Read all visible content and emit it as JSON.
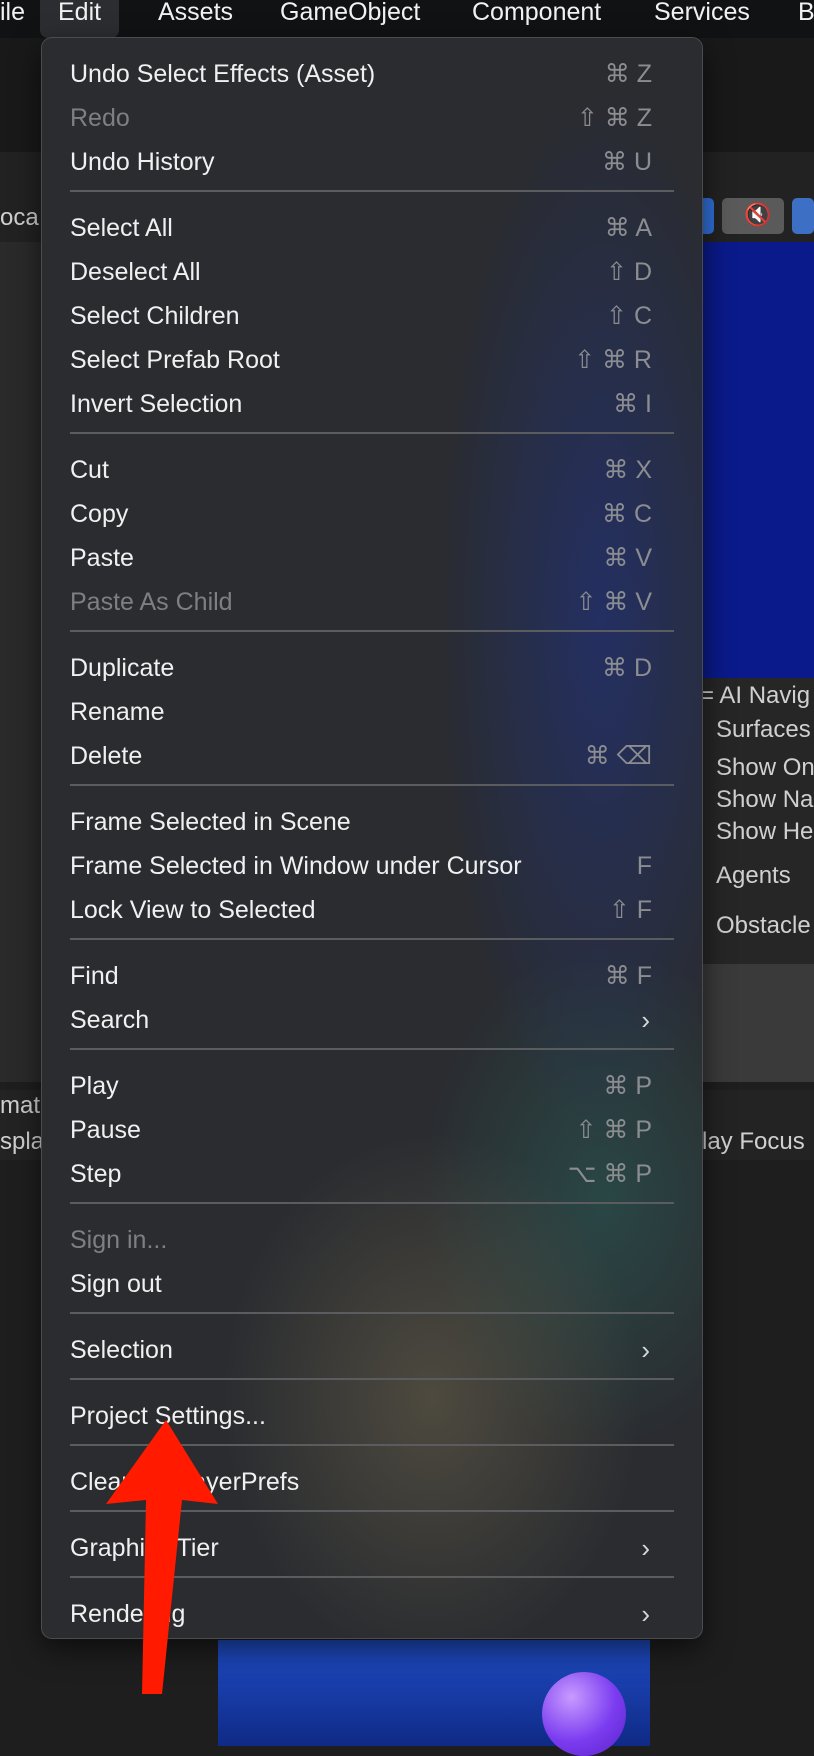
{
  "menubar": {
    "items": [
      "ile",
      "Edit",
      "Assets",
      "GameObject",
      "Component",
      "Services",
      "B"
    ]
  },
  "background": {
    "left_top": "oca",
    "left_mid1": "mat",
    "left_mid2": "splay",
    "nav_title": "= AI Navig",
    "nav_items": [
      "Surfaces",
      "Show On",
      "Show Na",
      "Show He",
      "Agents",
      "Obstacle"
    ],
    "play_focus": "lay Focus"
  },
  "edit_menu": {
    "groups": [
      [
        {
          "label": "Undo Select Effects (Asset)",
          "shortcut": "⌘ Z",
          "enabled": true
        },
        {
          "label": "Redo",
          "shortcut": "⇧ ⌘ Z",
          "enabled": false
        },
        {
          "label": "Undo History",
          "shortcut": "⌘ U",
          "enabled": true
        }
      ],
      [
        {
          "label": "Select All",
          "shortcut": "⌘ A",
          "enabled": true
        },
        {
          "label": "Deselect All",
          "shortcut": "⇧ D",
          "enabled": true
        },
        {
          "label": "Select Children",
          "shortcut": "⇧ C",
          "enabled": true
        },
        {
          "label": "Select Prefab Root",
          "shortcut": "⇧ ⌘ R",
          "enabled": true
        },
        {
          "label": "Invert Selection",
          "shortcut": "⌘ I",
          "enabled": true
        }
      ],
      [
        {
          "label": "Cut",
          "shortcut": "⌘ X",
          "enabled": true
        },
        {
          "label": "Copy",
          "shortcut": "⌘ C",
          "enabled": true
        },
        {
          "label": "Paste",
          "shortcut": "⌘ V",
          "enabled": true
        },
        {
          "label": "Paste As Child",
          "shortcut": "⇧ ⌘ V",
          "enabled": false
        }
      ],
      [
        {
          "label": "Duplicate",
          "shortcut": "⌘ D",
          "enabled": true
        },
        {
          "label": "Rename",
          "shortcut": "",
          "enabled": true
        },
        {
          "label": "Delete",
          "shortcut": "⌘ ⌫",
          "enabled": true
        }
      ],
      [
        {
          "label": "Frame Selected in Scene",
          "shortcut": "",
          "enabled": true
        },
        {
          "label": "Frame Selected in Window under Cursor",
          "shortcut": "F",
          "enabled": true
        },
        {
          "label": "Lock View to Selected",
          "shortcut": "⇧ F",
          "enabled": true
        }
      ],
      [
        {
          "label": "Find",
          "shortcut": "⌘ F",
          "enabled": true
        },
        {
          "label": "Search",
          "shortcut": "",
          "submenu": true,
          "enabled": true
        }
      ],
      [
        {
          "label": "Play",
          "shortcut": "⌘ P",
          "enabled": true
        },
        {
          "label": "Pause",
          "shortcut": "⇧ ⌘ P",
          "enabled": true
        },
        {
          "label": "Step",
          "shortcut": "⌥ ⌘ P",
          "enabled": true
        }
      ],
      [
        {
          "label": "Sign in...",
          "shortcut": "",
          "enabled": false
        },
        {
          "label": "Sign out",
          "shortcut": "",
          "enabled": true
        }
      ],
      [
        {
          "label": "Selection",
          "shortcut": "",
          "submenu": true,
          "enabled": true
        }
      ],
      [
        {
          "label": "Project Settings...",
          "shortcut": "",
          "enabled": true
        }
      ],
      [
        {
          "label": "Clear All PlayerPrefs",
          "shortcut": "",
          "enabled": true
        }
      ],
      [
        {
          "label": "Graphics Tier",
          "shortcut": "",
          "submenu": true,
          "enabled": true
        }
      ],
      [
        {
          "label": "Rendering",
          "shortcut": "",
          "submenu": true,
          "enabled": true
        }
      ]
    ]
  },
  "annotation": {
    "arrow_color": "#ff1a00",
    "target": "Project Settings..."
  }
}
